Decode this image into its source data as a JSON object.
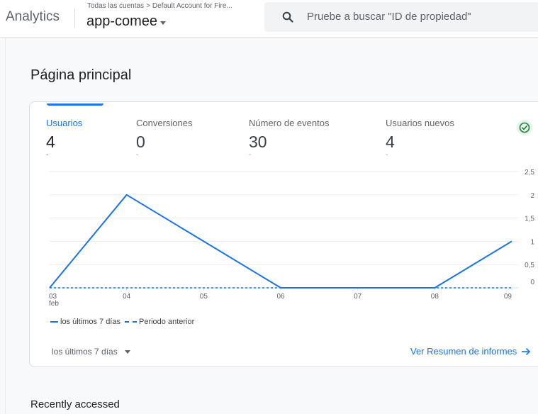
{
  "header": {
    "brand": "Analytics",
    "breadcrumb_root": "Todas las cuentas",
    "breadcrumb_separator": ">",
    "breadcrumb_account": "Default Account for Fire...",
    "account_name": "app-comee",
    "search_placeholder": "Pruebe a buscar \"ID de propiedad\""
  },
  "page": {
    "title": "Página principal"
  },
  "metrics": [
    {
      "label": "Usuarios",
      "value": "4",
      "change": "-"
    },
    {
      "label": "Conversiones",
      "value": "0",
      "change": "-"
    },
    {
      "label": "Número de eventos",
      "value": "30",
      "change": "-"
    },
    {
      "label": "Usuarios nuevos",
      "value": "4",
      "change": "-"
    }
  ],
  "chart_data": {
    "type": "line",
    "x": [
      "03",
      "04",
      "05",
      "06",
      "07",
      "08",
      "09"
    ],
    "x_sublabel": "feb",
    "series": [
      {
        "name": "los últimos 7 días",
        "style": "solid",
        "values": [
          0,
          2,
          1,
          0,
          0,
          0,
          1
        ]
      },
      {
        "name": "Periodo anterior",
        "style": "dashed",
        "values": [
          0,
          0,
          0,
          0,
          0,
          0,
          0
        ]
      }
    ],
    "y_ticks": [
      "2,5",
      "2",
      "1,5",
      "1",
      "0,5",
      "0"
    ],
    "ylim": [
      0,
      2.5
    ],
    "grid": true,
    "y_axis_side": "right",
    "legend_position": "bottom-left",
    "line_color": "#1a73e8"
  },
  "footer": {
    "period_label": "los últimos 7 días",
    "report_link": "Ver Resumen de informes"
  },
  "recent": {
    "title": "Recently accessed"
  },
  "colors": {
    "accent": "#1a73e8",
    "success": "#188038"
  }
}
